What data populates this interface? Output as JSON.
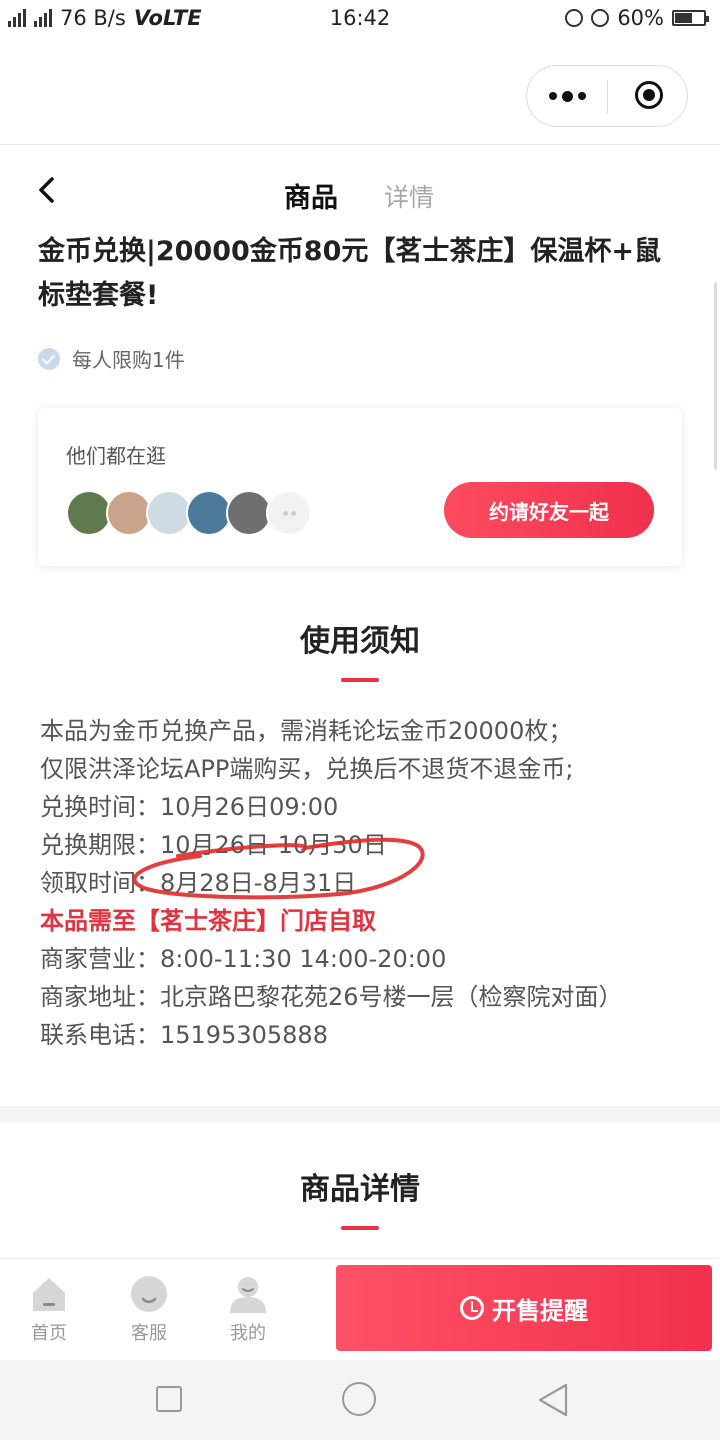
{
  "status_bar": {
    "network": "2G 4G",
    "speed": "76 B/s",
    "volte": "VoLTE",
    "time": "16:42",
    "battery": "60%",
    "battery_level": 0.6
  },
  "nav": {
    "tab_product": "商品",
    "tab_detail": "详情"
  },
  "product": {
    "title": "金币兑换|20000金币80元【茗士茶庄】保温杯+鼠标垫套餐!",
    "limit": "每人限购1件"
  },
  "friends": {
    "label": "他们都在逛",
    "invite_label": "约请好友一起",
    "avatar_colors": [
      "#5f7a4e",
      "#c9a48a",
      "#cfdbe2",
      "#4b7a9a",
      "#6f6f6f"
    ]
  },
  "notice": {
    "heading": "使用须知",
    "line1": "本品为金币兑换产品，需消耗论坛金币20000枚；",
    "line2": "仅限洪泽论坛APP端购买，兑换后不退货不退金币;",
    "line3": "兑换时间：10月26日09:00",
    "line4": "兑换期限：10月26日-10月30日",
    "line5": "领取时间：8月28日-8月31日",
    "line6": "本品需至【茗士茶庄】门店自取",
    "line7": "商家营业：8:00-11:30 14:00-20:00",
    "line8": "商家地址：北京路巴黎花苑26号楼一层（检察院对面）",
    "line9": "联系电话：15195305888"
  },
  "detail": {
    "heading": "商品详情"
  },
  "bottom_bar": {
    "home_label": "首页",
    "service_label": "客服",
    "mine_label": "我的",
    "remind_label": "开售提醒"
  },
  "colors": {
    "accent": "#f0304c",
    "muted_text": "#9a9a9a"
  }
}
